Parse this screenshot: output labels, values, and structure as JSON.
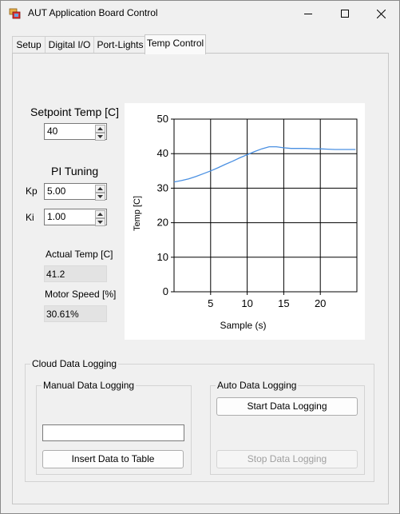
{
  "window": {
    "title": "AUT Application Board Control",
    "icon": "app-icon",
    "controls": [
      "minimize-icon",
      "maximize-icon",
      "close-icon"
    ]
  },
  "tabs": [
    {
      "label": "Setup"
    },
    {
      "label": "Digital I/O"
    },
    {
      "label": "Port-Lights"
    },
    {
      "label": "Temp Control",
      "active": true
    }
  ],
  "setpoint": {
    "label": "Setpoint Temp [C]",
    "value": "40"
  },
  "pi_tuning": {
    "label": "PI Tuning",
    "kp_label": "Kp",
    "kp_value": "5.00",
    "ki_label": "Ki",
    "ki_value": "1.00"
  },
  "actual_temp": {
    "label": "Actual Temp [C]",
    "value": "41.2"
  },
  "motor_speed": {
    "label": "Motor Speed [%]",
    "value": "30.61%"
  },
  "chart_data": {
    "type": "line",
    "xlabel": "Sample (s)",
    "ylabel": "Temp [C]",
    "xlim": [
      0,
      25
    ],
    "ylim": [
      0,
      50
    ],
    "x_ticks": [
      "5",
      "10",
      "15",
      "20"
    ],
    "y_ticks": [
      "0",
      "10",
      "20",
      "30",
      "40",
      "50"
    ],
    "grid": true,
    "series": [
      {
        "color": "#4a90e2",
        "x": [
          0,
          1,
          2,
          3,
          4,
          5,
          6,
          7,
          8,
          9,
          10,
          11,
          12,
          13,
          14,
          15,
          16,
          17,
          18,
          19,
          20,
          21,
          22,
          23,
          24.8
        ],
        "y": [
          31.8,
          32.2,
          32.7,
          33.4,
          34.2,
          35.0,
          35.9,
          36.9,
          37.8,
          38.8,
          39.7,
          40.6,
          41.4,
          42.0,
          42.0,
          41.7,
          41.5,
          41.5,
          41.5,
          41.4,
          41.4,
          41.3,
          41.2,
          41.2,
          41.2
        ]
      }
    ]
  },
  "cloud_logging": {
    "label": "Cloud Data Logging",
    "manual": {
      "label": "Manual Data Logging",
      "input_value": "",
      "insert_button": "Insert Data to Table"
    },
    "auto": {
      "label": "Auto Data Logging",
      "start_button": "Start Data Logging",
      "stop_button": "Stop Data Logging"
    }
  }
}
